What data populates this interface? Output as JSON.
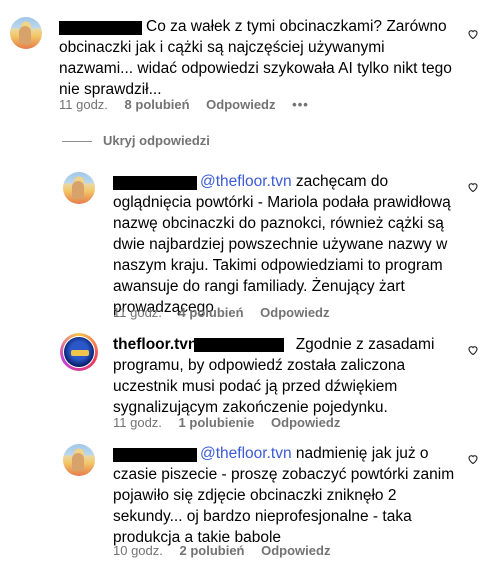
{
  "comments": [
    {
      "text": "Co za wałek z tymi obcinaczkami? Zarówno obcinaczki jak i cążki są najczęściej używanymi nazwami... widać odpowiedzi szykowała AI tylko nikt tego nie sprawdził...",
      "time": "11 godz.",
      "likes": "8 polubień",
      "reply": "Odpowiedz",
      "more": "•••"
    }
  ],
  "hide_replies": "Ukryj odpowiedzi",
  "replies": [
    {
      "mention": "@thefloor.tvn",
      "text": " zachęcam do oglądnięcia powtórki - Mariola podała prawidłową nazwę obcinaczki do paznokci, również cążki są dwie najbardziej powszechnie używane nazwy w naszym kraju. Takimi odpowiedziami to program awansuje do rangi familiady. Żenujący żart prowadzącego",
      "time": "11 godz.",
      "likes": "4 polubień",
      "reply": "Odpowiedz"
    },
    {
      "username": "thefloor.tvn",
      "text": " Zgodnie z zasadami programu, by odpowiedź została zaliczona uczestnik musi podać ją przed dźwiękiem sygnalizującym zakończenie pojedynku.",
      "time": "11 godz.",
      "likes": "1 polubienie",
      "reply": "Odpowiedz"
    },
    {
      "mention": "@thefloor.tvn",
      "text": " nadmienię jak już o czasie piszecie - proszę zobaczyć powtórki zanim pojawiło się zdjęcie obcinaczki zniknęło 2 sekundy... oj bardzo nieprofesjonalne - taka produkcja a takie babole",
      "time": "10 godz.",
      "likes": "2 polubień",
      "reply": "Odpowiedz"
    }
  ],
  "icons": {
    "like": "heart-icon",
    "more": "more-options-icon"
  }
}
